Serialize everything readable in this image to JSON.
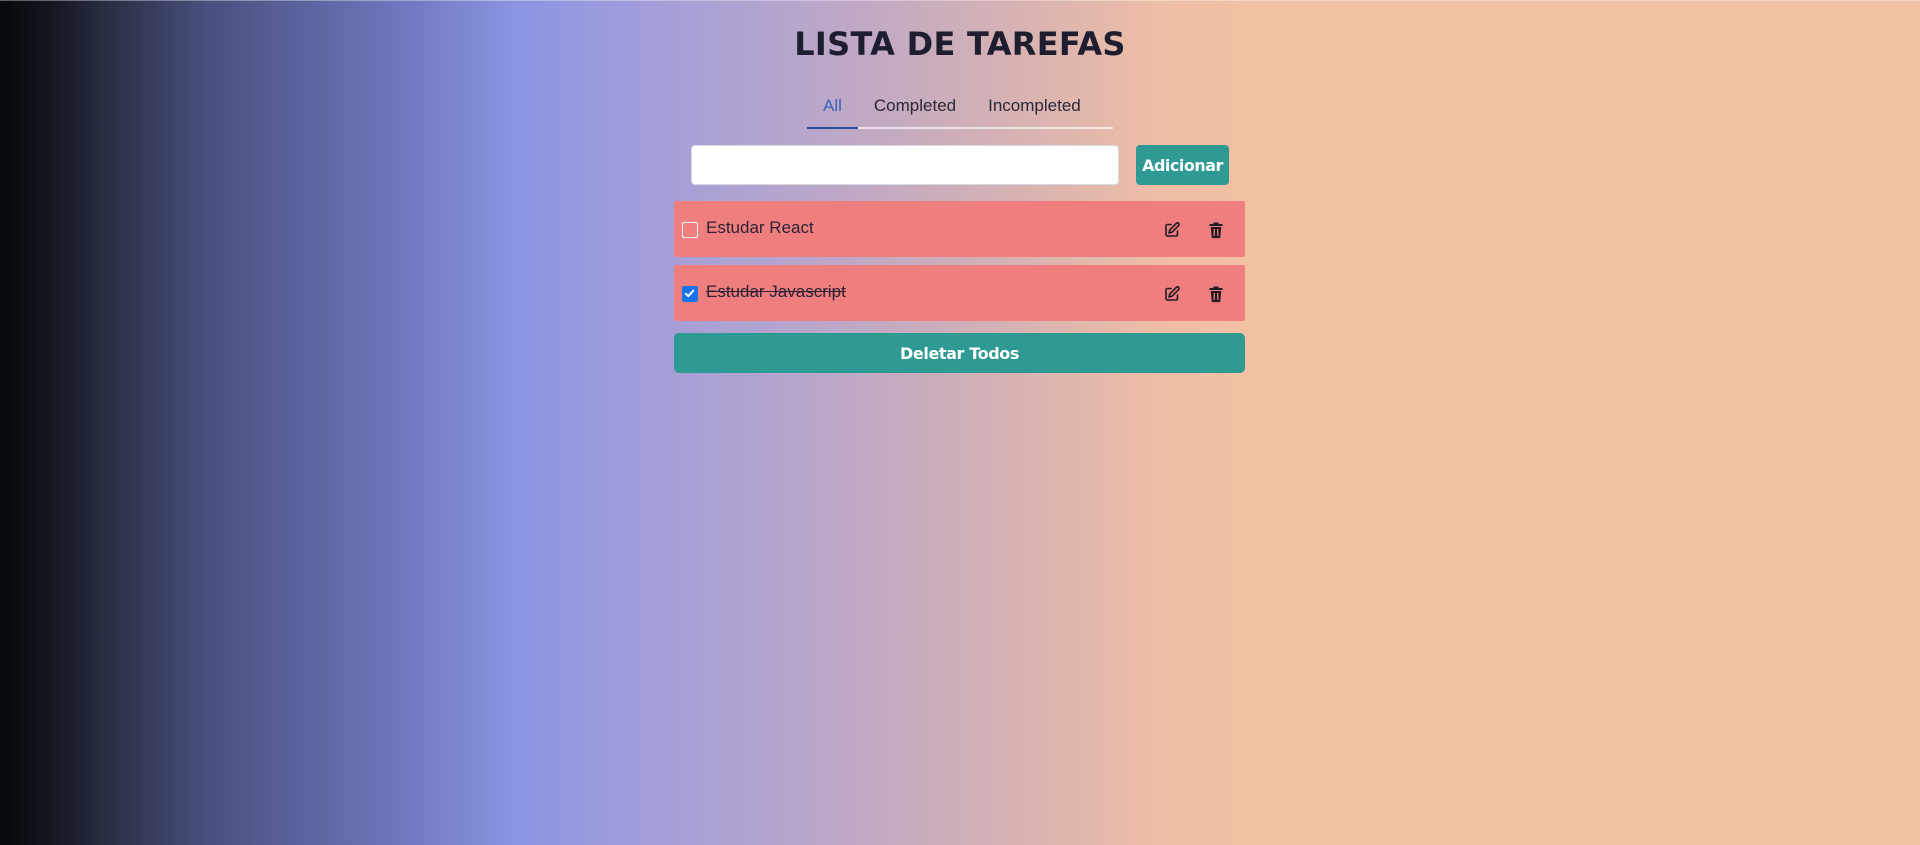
{
  "app": {
    "title": "LISTA DE TAREFAS"
  },
  "tabs": [
    {
      "label": "All",
      "active": true
    },
    {
      "label": "Completed",
      "active": false
    },
    {
      "label": "Incompleted",
      "active": false
    }
  ],
  "add_form": {
    "input_value": "",
    "placeholder": "",
    "button_label": "Adicionar"
  },
  "tasks": [
    {
      "text": "Estudar React",
      "completed": false
    },
    {
      "text": "Estudar Javascript",
      "completed": true
    }
  ],
  "actions": {
    "delete_all_label": "Deletar Todos"
  },
  "icons": {
    "edit": "edit-icon",
    "delete": "trash-icon",
    "check": "checkmark-icon"
  },
  "colors": {
    "accent": "#2f9a94",
    "task_background": "#ef7f7e",
    "active_tab": "#3a62c0",
    "checkbox_checked": "#1a73e8"
  }
}
